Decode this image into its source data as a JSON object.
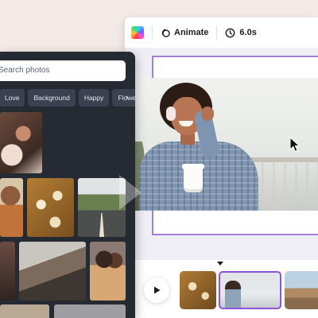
{
  "toolbar": {
    "color_icon": "color-palette-icon",
    "animate_icon": "animate-icon",
    "animate_label": "Animate",
    "timer_icon": "clock-icon",
    "duration_label": "6.0s"
  },
  "photo_panel": {
    "search_placeholder": "Search photos",
    "chips": [
      "Love",
      "Background",
      "Happy",
      "Flowers"
    ],
    "chips_next_icon": "chevron-right-icon"
  },
  "timeline": {
    "play_icon": "play-icon",
    "clips": [
      "flowers-clip",
      "woman-clip",
      "landscape-clip"
    ]
  },
  "colors": {
    "accent": "#8b55d6",
    "panel_bg": "#252a33",
    "page_bg": "#f3e9e6"
  }
}
